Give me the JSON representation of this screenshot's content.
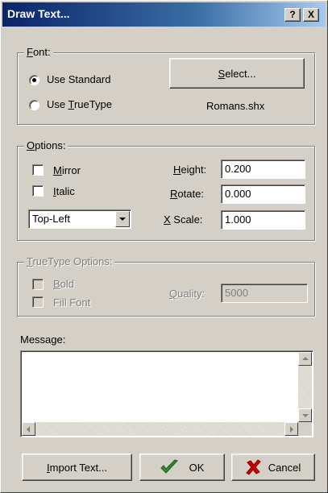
{
  "window": {
    "title": "Draw Text...",
    "help_label": "?",
    "close_label": "X"
  },
  "font": {
    "legend": "Font:",
    "use_standard_label": "Use Standard",
    "use_truetype_label": "Use TrueType",
    "selected_option": "Use Standard",
    "select_button_label": "Select...",
    "font_file": "Romans.shx"
  },
  "options": {
    "legend": "Options:",
    "mirror_label": "Mirror",
    "mirror_checked": false,
    "italic_label": "Italic",
    "italic_checked": false,
    "alignment_value": "Top-Left",
    "height_label": "Height:",
    "height_value": "0.200",
    "rotate_label": "Rotate:",
    "rotate_value": "0.000",
    "xscale_label": "X Scale:",
    "xscale_value": "1.000"
  },
  "truetype_options": {
    "legend": "TrueType Options:",
    "bold_label": "Bold",
    "fill_font_label": "Fill Font",
    "quality_label": "Quality:",
    "quality_value": "5000",
    "enabled": false
  },
  "message": {
    "label": "Message:",
    "value": ""
  },
  "buttons": {
    "import_label": "Import Text...",
    "ok_label": "OK",
    "cancel_label": "Cancel"
  },
  "colors": {
    "title_start": "#0a246a",
    "title_end": "#a6caf0",
    "ok_check": "#2e8b2e",
    "cancel_x": "#cc0000",
    "face": "#d4d0c8"
  }
}
